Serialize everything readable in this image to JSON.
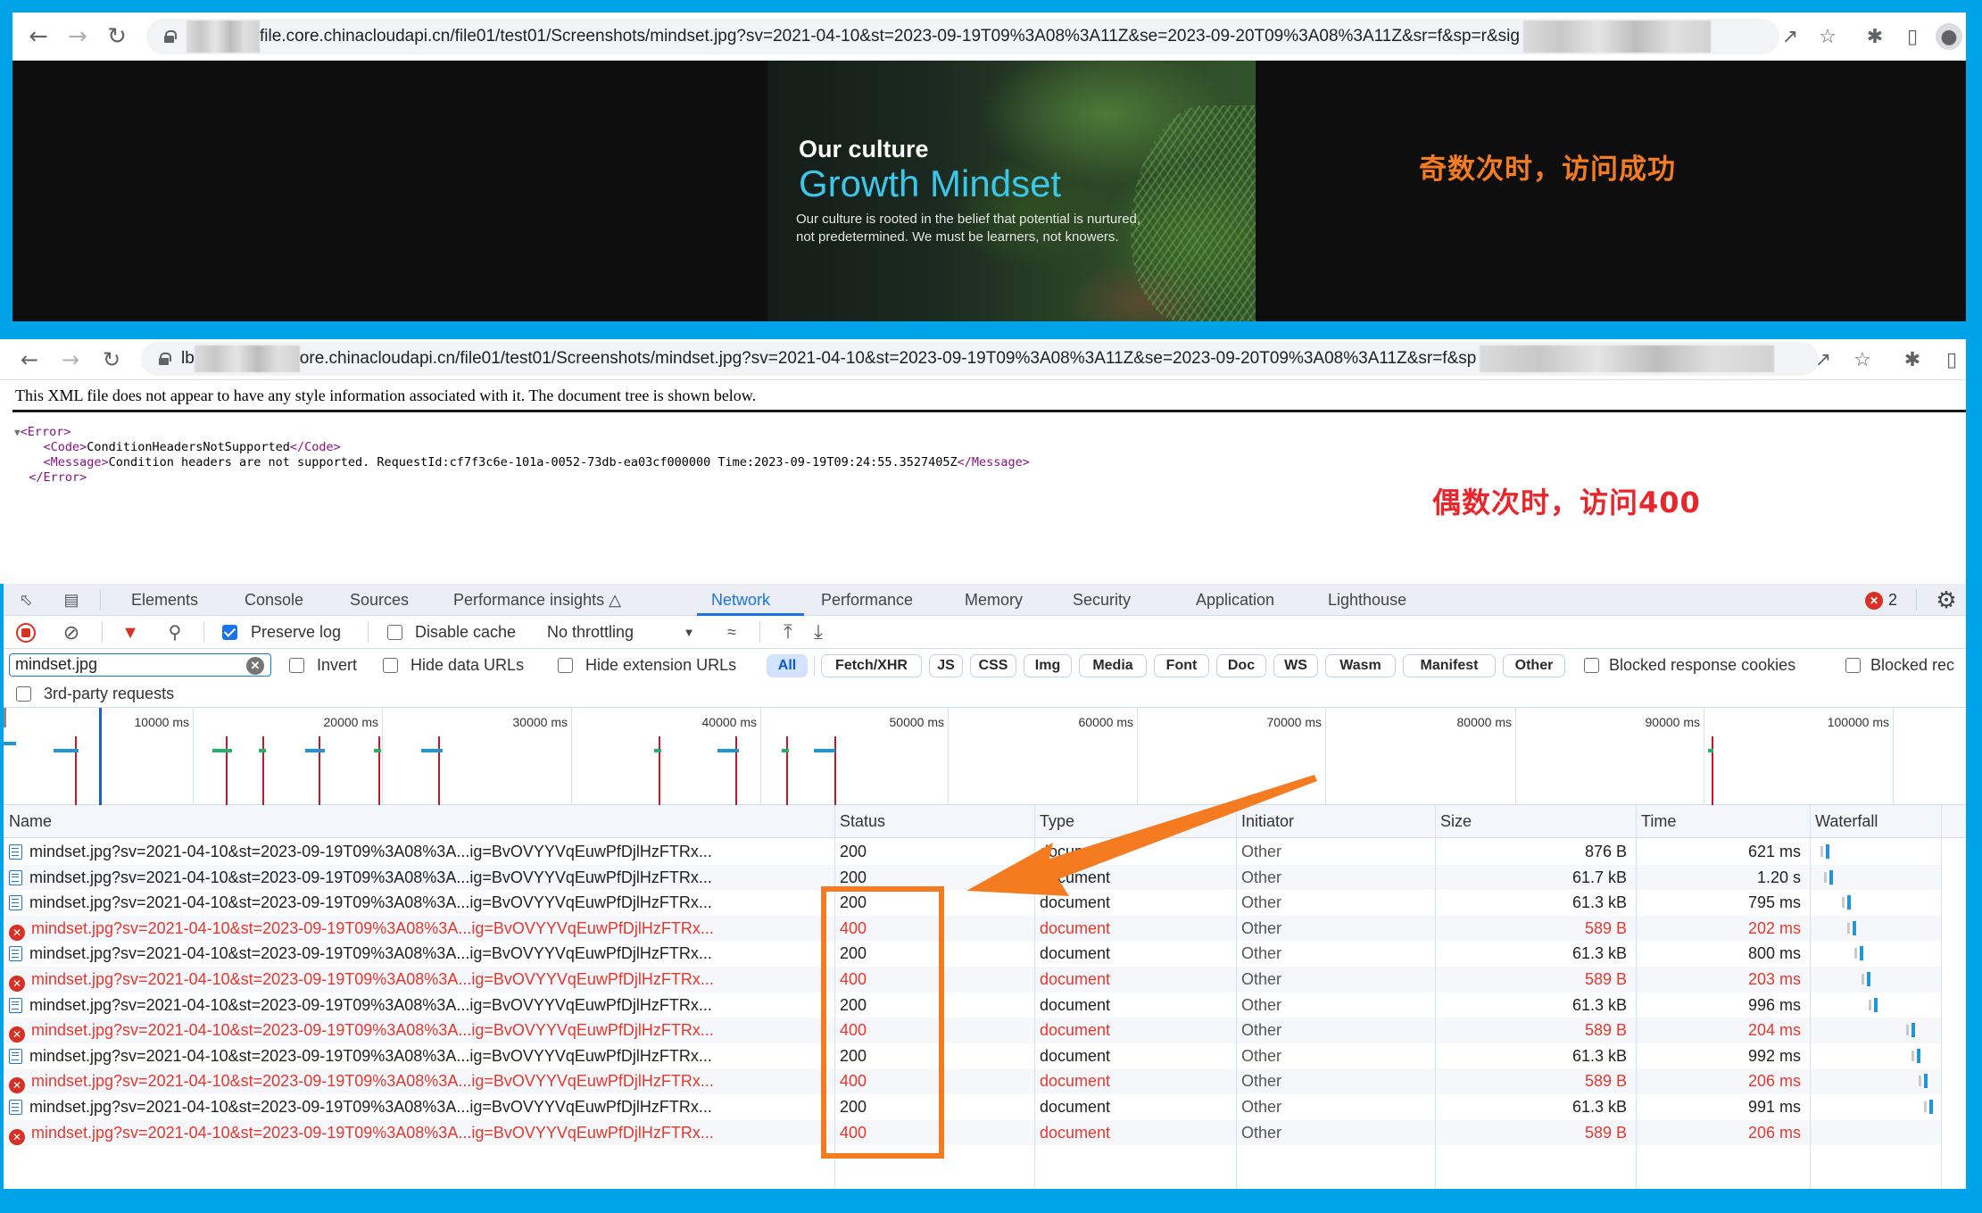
{
  "top_browser": {
    "url_visible": "file.core.chinacloudapi.cn/file01/test01/Screenshots/mindset.jpg?sv=2021-04-10&st=2023-09-19T09%3A08%3A11Z&se=2023-09-20T09%3A08%3A11Z&sr=f&sp=r&sig",
    "icons": [
      "back-icon",
      "forward-icon",
      "reload-icon",
      "lock-icon",
      "share-icon",
      "star-icon",
      "extensions-icon",
      "side-panel-icon",
      "profile-icon"
    ]
  },
  "mindset_image": {
    "subtitle": "Our culture",
    "title": "Growth Mindset",
    "body": "Our culture is rooted in the belief that potential is nurtured, not predetermined. We must be learners, not knowers."
  },
  "annotations": {
    "odd_success": "奇数次时，访问成功",
    "even_400": "偶数次时，访问400",
    "colors": {
      "orange": "#f47b20",
      "red": "#e8262c",
      "frame_blue": "#00a2e8"
    }
  },
  "second_browser": {
    "url_prefix": "lb",
    "url_visible": "ore.chinacloudapi.cn/file01/test01/Screenshots/mindset.jpg?sv=2021-04-10&st=2023-09-19T09%3A08%3A11Z&se=2023-09-20T09%3A08%3A11Z&sr=f&sp"
  },
  "xml": {
    "banner": "This XML file does not appear to have any style information associated with it. The document tree is shown below.",
    "open_error": "<Error>",
    "code_open": "<Code>",
    "code_value": "ConditionHeadersNotSupported",
    "code_close": "</Code>",
    "message_open": "<Message>",
    "message_value": "Condition headers are not supported. RequestId:cf7f3c6e-101a-0052-73db-ea03cf000000 Time:2023-09-19T09:24:55.3527405Z",
    "message_close": "</Message>",
    "close_error": "</Error>"
  },
  "devtools": {
    "tabs": [
      "Elements",
      "Console",
      "Sources",
      "Performance insights",
      "Network",
      "Performance",
      "Memory",
      "Security",
      "Application",
      "Lighthouse"
    ],
    "active_tab": "Network",
    "error_count": "2",
    "toolbar": {
      "preserve_log": "Preserve log",
      "preserve_log_checked": true,
      "disable_cache": "Disable cache",
      "throttling": "No throttling"
    },
    "filter": {
      "value": "mindset.jpg",
      "invert": "Invert",
      "hide_data_urls": "Hide data URLs",
      "hide_extension_urls": "Hide extension URLs",
      "types": [
        "All",
        "Fetch/XHR",
        "JS",
        "CSS",
        "Img",
        "Media",
        "Font",
        "Doc",
        "WS",
        "Wasm",
        "Manifest",
        "Other"
      ],
      "selected_type": "All",
      "blocked_response_cookies": "Blocked response cookies",
      "blocked_requests": "Blocked rec",
      "third_party": "3rd-party requests"
    },
    "timeline": {
      "ticks": [
        "10000 ms",
        "20000 ms",
        "30000 ms",
        "40000 ms",
        "50000 ms",
        "60000 ms",
        "70000 ms",
        "80000 ms",
        "90000 ms",
        "100000 ms"
      ]
    },
    "table": {
      "columns": [
        "Name",
        "Status",
        "Type",
        "Initiator",
        "Size",
        "Time",
        "Waterfall"
      ],
      "rows": [
        {
          "name": "mindset.jpg?sv=2021-04-10&st=2023-09-19T09%3A08%3A...ig=BvOVYYVqEuwPfDjlHzFTRx...",
          "status": "200",
          "type": "document",
          "initiator": "Other",
          "size": "876 B",
          "time": "621 ms",
          "error": false
        },
        {
          "name": "mindset.jpg?sv=2021-04-10&st=2023-09-19T09%3A08%3A...ig=BvOVYYVqEuwPfDjlHzFTRx...",
          "status": "200",
          "type": "document",
          "initiator": "Other",
          "size": "61.7 kB",
          "time": "1.20 s",
          "error": false
        },
        {
          "name": "mindset.jpg?sv=2021-04-10&st=2023-09-19T09%3A08%3A...ig=BvOVYYVqEuwPfDjlHzFTRx...",
          "status": "200",
          "type": "document",
          "initiator": "Other",
          "size": "61.3 kB",
          "time": "795 ms",
          "error": false
        },
        {
          "name": "mindset.jpg?sv=2021-04-10&st=2023-09-19T09%3A08%3A...ig=BvOVYYVqEuwPfDjlHzFTRx...",
          "status": "400",
          "type": "document",
          "initiator": "Other",
          "size": "589 B",
          "time": "202 ms",
          "error": true
        },
        {
          "name": "mindset.jpg?sv=2021-04-10&st=2023-09-19T09%3A08%3A...ig=BvOVYYVqEuwPfDjlHzFTRx...",
          "status": "200",
          "type": "document",
          "initiator": "Other",
          "size": "61.3 kB",
          "time": "800 ms",
          "error": false
        },
        {
          "name": "mindset.jpg?sv=2021-04-10&st=2023-09-19T09%3A08%3A...ig=BvOVYYVqEuwPfDjlHzFTRx...",
          "status": "400",
          "type": "document",
          "initiator": "Other",
          "size": "589 B",
          "time": "203 ms",
          "error": true
        },
        {
          "name": "mindset.jpg?sv=2021-04-10&st=2023-09-19T09%3A08%3A...ig=BvOVYYVqEuwPfDjlHzFTRx...",
          "status": "200",
          "type": "document",
          "initiator": "Other",
          "size": "61.3 kB",
          "time": "996 ms",
          "error": false
        },
        {
          "name": "mindset.jpg?sv=2021-04-10&st=2023-09-19T09%3A08%3A...ig=BvOVYYVqEuwPfDjlHzFTRx...",
          "status": "400",
          "type": "document",
          "initiator": "Other",
          "size": "589 B",
          "time": "204 ms",
          "error": true
        },
        {
          "name": "mindset.jpg?sv=2021-04-10&st=2023-09-19T09%3A08%3A...ig=BvOVYYVqEuwPfDjlHzFTRx...",
          "status": "200",
          "type": "document",
          "initiator": "Other",
          "size": "61.3 kB",
          "time": "992 ms",
          "error": false
        },
        {
          "name": "mindset.jpg?sv=2021-04-10&st=2023-09-19T09%3A08%3A...ig=BvOVYYVqEuwPfDjlHzFTRx...",
          "status": "400",
          "type": "document",
          "initiator": "Other",
          "size": "589 B",
          "time": "206 ms",
          "error": true
        },
        {
          "name": "mindset.jpg?sv=2021-04-10&st=2023-09-19T09%3A08%3A...ig=BvOVYYVqEuwPfDjlHzFTRx...",
          "status": "200",
          "type": "document",
          "initiator": "Other",
          "size": "61.3 kB",
          "time": "991 ms",
          "error": false
        },
        {
          "name": "mindset.jpg?sv=2021-04-10&st=2023-09-19T09%3A08%3A...ig=BvOVYYVqEuwPfDjlHzFTRx...",
          "status": "400",
          "type": "document",
          "initiator": "Other",
          "size": "589 B",
          "time": "206 ms",
          "error": true
        }
      ]
    }
  }
}
